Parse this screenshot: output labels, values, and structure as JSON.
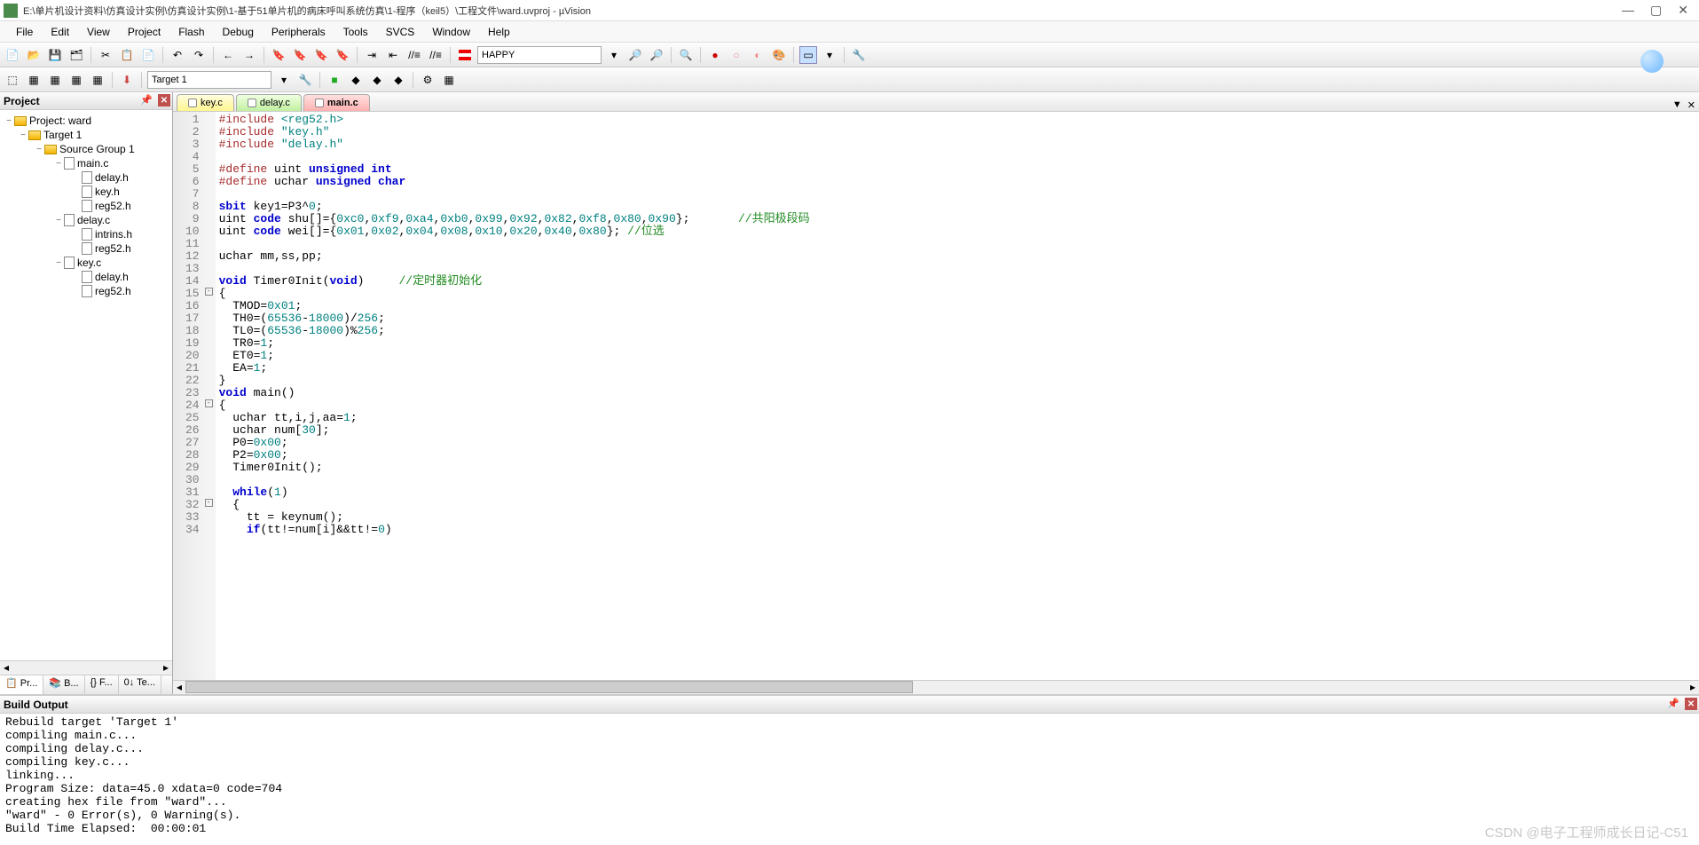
{
  "window": {
    "title": "E:\\单片机设计资料\\仿真设计实例\\仿真设计实例\\1-基于51单片机的病床呼叫系统仿真\\1-程序（keil5）\\工程文件\\ward.uvproj - µVision",
    "min": "—",
    "max": "▢",
    "close": "✕"
  },
  "menu": {
    "items": [
      "File",
      "Edit",
      "View",
      "Project",
      "Flash",
      "Debug",
      "Peripherals",
      "Tools",
      "SVCS",
      "Window",
      "Help"
    ]
  },
  "toolbar1": {
    "search_value": "HAPPY"
  },
  "toolbar2": {
    "target_value": "Target 1"
  },
  "project_panel": {
    "title": "Project",
    "tree": [
      {
        "depth": 0,
        "toggle": "−",
        "icon": "folder",
        "label": "Project: ward"
      },
      {
        "depth": 1,
        "toggle": "−",
        "icon": "target",
        "label": "Target 1"
      },
      {
        "depth": 2,
        "toggle": "−",
        "icon": "folder",
        "label": "Source Group 1"
      },
      {
        "depth": 3,
        "toggle": "−",
        "icon": "file",
        "label": "main.c"
      },
      {
        "depth": 4,
        "toggle": "",
        "icon": "file",
        "label": "delay.h"
      },
      {
        "depth": 4,
        "toggle": "",
        "icon": "file",
        "label": "key.h"
      },
      {
        "depth": 4,
        "toggle": "",
        "icon": "file",
        "label": "reg52.h"
      },
      {
        "depth": 3,
        "toggle": "−",
        "icon": "file",
        "label": "delay.c"
      },
      {
        "depth": 4,
        "toggle": "",
        "icon": "file",
        "label": "intrins.h"
      },
      {
        "depth": 4,
        "toggle": "",
        "icon": "file",
        "label": "reg52.h"
      },
      {
        "depth": 3,
        "toggle": "−",
        "icon": "file",
        "label": "key.c"
      },
      {
        "depth": 4,
        "toggle": "",
        "icon": "file",
        "label": "delay.h"
      },
      {
        "depth": 4,
        "toggle": "",
        "icon": "file",
        "label": "reg52.h"
      }
    ],
    "bottom_tabs": [
      "📋 Pr...",
      "📚 B...",
      "{} F...",
      "0↓ Te..."
    ]
  },
  "tabs": {
    "files": [
      {
        "label": "key.c",
        "cls": "ft-yellow"
      },
      {
        "label": "delay.c",
        "cls": "ft-green"
      },
      {
        "label": "main.c",
        "cls": "ft-red"
      }
    ],
    "actions": [
      "▼",
      "✕"
    ]
  },
  "code": {
    "lines": [
      {
        "n": 1,
        "fold": "",
        "html": "<span class='pp'>#include</span> <span class='str'>&lt;reg52.h&gt;</span>"
      },
      {
        "n": 2,
        "fold": "",
        "html": "<span class='pp'>#include</span> <span class='str'>\"key.h\"</span>"
      },
      {
        "n": 3,
        "fold": "",
        "html": "<span class='pp'>#include</span> <span class='str'>\"delay.h\"</span>"
      },
      {
        "n": 4,
        "fold": "",
        "html": ""
      },
      {
        "n": 5,
        "fold": "",
        "html": "<span class='pp'>#define</span> uint <span class='kw'>unsigned int</span>"
      },
      {
        "n": 6,
        "fold": "",
        "html": "<span class='pp'>#define</span> uchar <span class='kw'>unsigned char</span>"
      },
      {
        "n": 7,
        "fold": "",
        "html": ""
      },
      {
        "n": 8,
        "fold": "",
        "html": "<span class='kw'>sbit</span> key1=P3^<span class='num'>0</span>;"
      },
      {
        "n": 9,
        "fold": "",
        "html": "uint <span class='kw'>code</span> shu[]={<span class='num'>0xc0</span>,<span class='num'>0xf9</span>,<span class='num'>0xa4</span>,<span class='num'>0xb0</span>,<span class='num'>0x99</span>,<span class='num'>0x92</span>,<span class='num'>0x82</span>,<span class='num'>0xf8</span>,<span class='num'>0x80</span>,<span class='num'>0x90</span>};       <span class='cmt'>//共阳极段码</span>"
      },
      {
        "n": 10,
        "fold": "",
        "html": "uint <span class='kw'>code</span> wei[]={<span class='num'>0x01</span>,<span class='num'>0x02</span>,<span class='num'>0x04</span>,<span class='num'>0x08</span>,<span class='num'>0x10</span>,<span class='num'>0x20</span>,<span class='num'>0x40</span>,<span class='num'>0x80</span>}; <span class='cmt'>//位选</span>"
      },
      {
        "n": 11,
        "fold": "",
        "html": ""
      },
      {
        "n": 12,
        "fold": "",
        "html": "uchar mm,ss,pp;"
      },
      {
        "n": 13,
        "fold": "",
        "html": ""
      },
      {
        "n": 14,
        "fold": "",
        "html": "<span class='kw'>void</span> Timer0Init(<span class='kw'>void</span>)     <span class='cmt'>//定时器初始化</span>"
      },
      {
        "n": 15,
        "fold": "-",
        "html": "{"
      },
      {
        "n": 16,
        "fold": "",
        "html": "  TMOD=<span class='num'>0x01</span>;"
      },
      {
        "n": 17,
        "fold": "",
        "html": "  TH0=(<span class='num'>65536</span>-<span class='num'>18000</span>)/<span class='num'>256</span>;"
      },
      {
        "n": 18,
        "fold": "",
        "html": "  TL0=(<span class='num'>65536</span>-<span class='num'>18000</span>)%<span class='num'>256</span>;"
      },
      {
        "n": 19,
        "fold": "",
        "html": "  TR0=<span class='num'>1</span>;"
      },
      {
        "n": 20,
        "fold": "",
        "html": "  ET0=<span class='num'>1</span>;"
      },
      {
        "n": 21,
        "fold": "",
        "html": "  EA=<span class='num'>1</span>;"
      },
      {
        "n": 22,
        "fold": "",
        "html": "}"
      },
      {
        "n": 23,
        "fold": "",
        "html": "<span class='kw'>void</span> main()"
      },
      {
        "n": 24,
        "fold": "-",
        "html": "{"
      },
      {
        "n": 25,
        "fold": "",
        "html": "  uchar tt,i,j,aa=<span class='num'>1</span>;"
      },
      {
        "n": 26,
        "fold": "",
        "html": "  uchar num[<span class='num'>30</span>];"
      },
      {
        "n": 27,
        "fold": "",
        "html": "  P0=<span class='num'>0x00</span>;"
      },
      {
        "n": 28,
        "fold": "",
        "html": "  P2=<span class='num'>0x00</span>;"
      },
      {
        "n": 29,
        "fold": "",
        "html": "  Timer0Init();"
      },
      {
        "n": 30,
        "fold": "",
        "html": ""
      },
      {
        "n": 31,
        "fold": "",
        "html": "  <span class='kw'>while</span>(<span class='num'>1</span>)"
      },
      {
        "n": 32,
        "fold": "-",
        "html": "  {"
      },
      {
        "n": 33,
        "fold": "",
        "html": "    tt = keynum();"
      },
      {
        "n": 34,
        "fold": "",
        "html": "    <span class='kw'>if</span>(tt!=num[i]&amp;&amp;tt!=<span class='num'>0</span>)"
      }
    ]
  },
  "build": {
    "title": "Build Output",
    "lines": [
      "Rebuild target 'Target 1'",
      "compiling main.c...",
      "compiling delay.c...",
      "compiling key.c...",
      "linking...",
      "Program Size: data=45.0 xdata=0 code=704",
      "creating hex file from \"ward\"...",
      "\"ward\" - 0 Error(s), 0 Warning(s).",
      "Build Time Elapsed:  00:00:01"
    ]
  },
  "watermark": "CSDN @电子工程师成长日记-C51"
}
